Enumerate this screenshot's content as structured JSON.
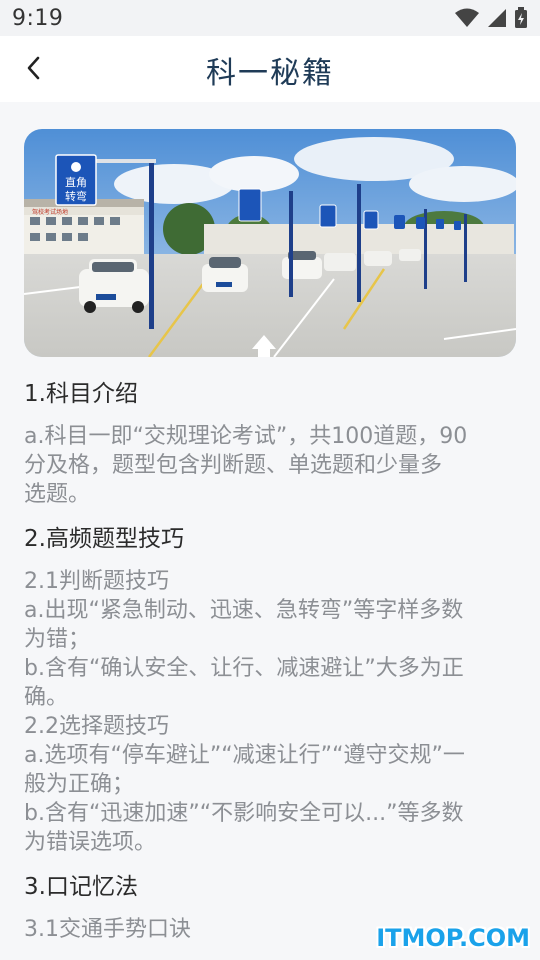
{
  "status_bar": {
    "time": "9:19",
    "icons": [
      "wifi-icon",
      "signal-icon",
      "battery-charging-icon"
    ]
  },
  "header": {
    "title": "科一秘籍",
    "back_icon": "chevron-left-icon"
  },
  "hero_image": {
    "sign_top": "直角",
    "sign_bottom": "转弯",
    "banner_text": "驾校考试场地"
  },
  "article": {
    "sec1_title": "1.科目介绍",
    "sec1_line1": "a.科目一即“交规理论考试”，共100道题，90",
    "sec1_line2": "分及格，题型包含判断题、单选题和少量多",
    "sec1_line3": "选题。",
    "sec2_title": "2.高频题型技巧",
    "sec2_1_title": "2.1判断题技巧",
    "sec2_1_a1": "a.出现“紧急制动、迅速、急转弯”等字样多数",
    "sec2_1_a2": "为错；",
    "sec2_1_b1": "b.含有“确认安全、让行、减速避让”大多为正",
    "sec2_1_b2": "确。",
    "sec2_2_title": "2.2选择题技巧",
    "sec2_2_a1": "a.选项有“停车避让”“减速让行”“遵守交规”一",
    "sec2_2_a2": "般为正确；",
    "sec2_2_b1": "b.含有“迅速加速”“不影响安全可以...”等多数",
    "sec2_2_b2": "为错误选项。",
    "sec3_title": "3.口记忆法",
    "sec3_1_title": "3.1交通手势口诀"
  },
  "watermark": "ITMOP.COM"
}
